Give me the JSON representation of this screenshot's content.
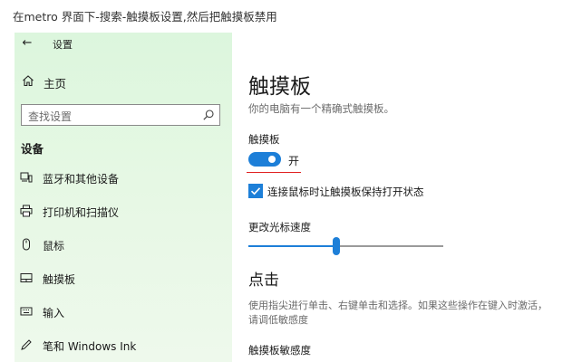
{
  "caption": "在metro 界面下-搜索-触摸板设置,然后把触摸板禁用",
  "window": {
    "title": "设置"
  },
  "sidebar": {
    "home_label": "主页",
    "search": {
      "placeholder": "查找设置"
    },
    "section_title": "设备",
    "items": [
      {
        "label": "蓝牙和其他设备",
        "icon": "bluetooth-devices-icon"
      },
      {
        "label": "打印机和扫描仪",
        "icon": "printer-icon"
      },
      {
        "label": "鼠标",
        "icon": "mouse-icon"
      },
      {
        "label": "触摸板",
        "icon": "touchpad-icon"
      },
      {
        "label": "输入",
        "icon": "keyboard-icon"
      },
      {
        "label": "笔和 Windows Ink",
        "icon": "pen-icon"
      }
    ]
  },
  "main": {
    "title": "触摸板",
    "subtitle": "你的电脑有一个精确式触摸板。",
    "touchpad_toggle": {
      "label": "触摸板",
      "state_text": "开",
      "on": true
    },
    "checkbox": {
      "label": "连接鼠标时让触摸板保持打开状态",
      "checked": true
    },
    "cursor_speed": {
      "label": "更改光标速度",
      "value_fraction": 0.45
    },
    "tap_section": {
      "title": "点击",
      "description": "使用指尖进行单击、右键单击和选择。如果这些操作在键入时激活，请调低敏感度"
    },
    "sensitivity_label": "触摸板敏感度"
  },
  "colors": {
    "accent": "#1d7fd8",
    "highlight": "#e01f1f",
    "sidebar_bg": "#e2f7e2"
  }
}
